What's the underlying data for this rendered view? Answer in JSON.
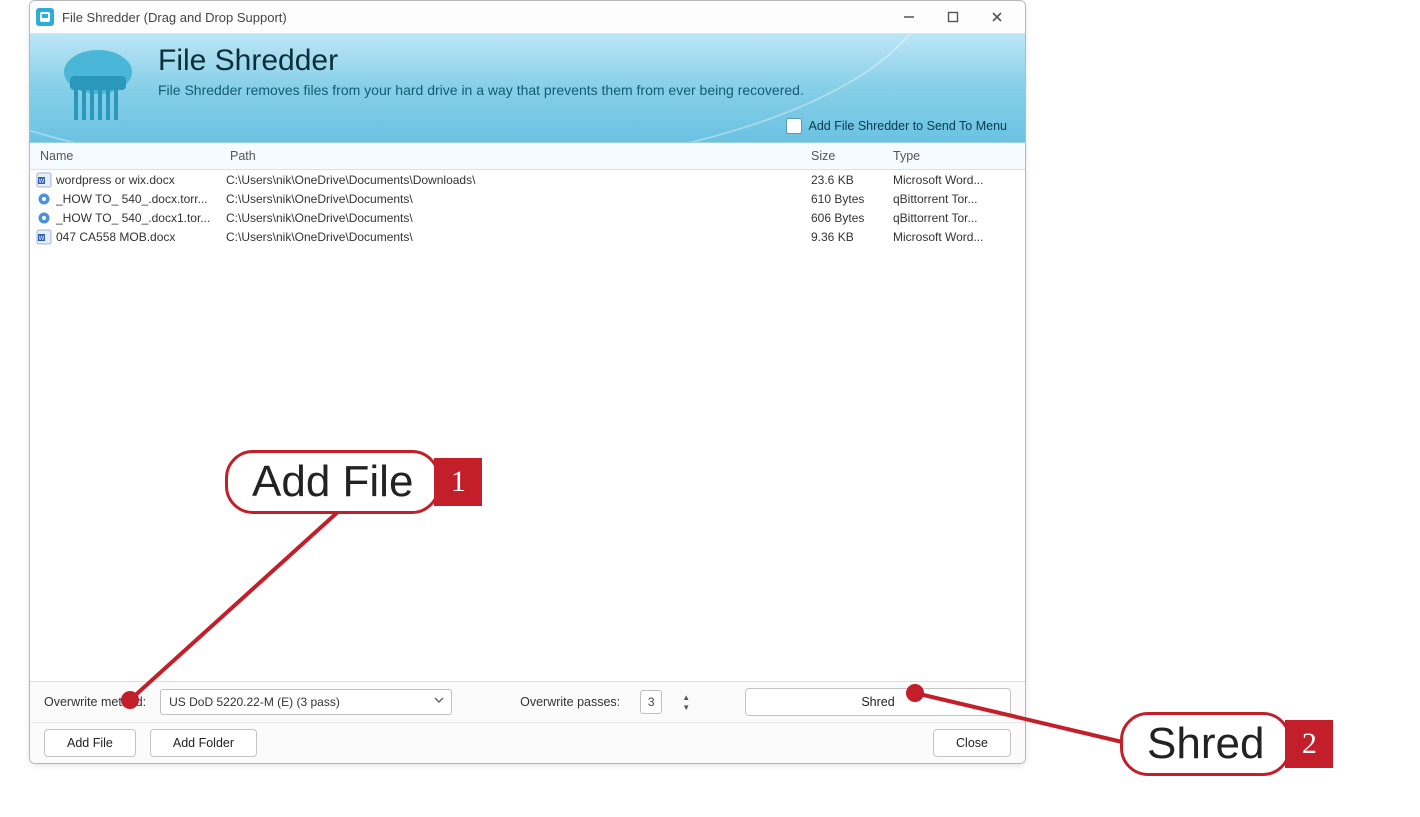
{
  "window": {
    "title": "File Shredder (Drag and Drop Support)"
  },
  "banner": {
    "heading": "File Shredder",
    "subheading": "File Shredder removes files from your hard drive in a way that prevents them from ever being recovered.",
    "sendto_label": "Add File Shredder to Send To Menu"
  },
  "columns": {
    "name": "Name",
    "path": "Path",
    "size": "Size",
    "type": "Type"
  },
  "files": [
    {
      "icon": "docx",
      "name": "wordpress or wix.docx",
      "path": "C:\\Users\\nik\\OneDrive\\Documents\\Downloads\\",
      "size": "23.6 KB",
      "type": "Microsoft Word..."
    },
    {
      "icon": "torrent",
      "name": "_HOW TO_ 540_.docx.torr...",
      "path": "C:\\Users\\nik\\OneDrive\\Documents\\",
      "size": "610 Bytes",
      "type": "qBittorrent Tor..."
    },
    {
      "icon": "torrent",
      "name": "_HOW TO_ 540_.docx1.tor...",
      "path": "C:\\Users\\nik\\OneDrive\\Documents\\",
      "size": "606 Bytes",
      "type": "qBittorrent Tor..."
    },
    {
      "icon": "docx",
      "name": "047 CA558 MOB.docx",
      "path": "C:\\Users\\nik\\OneDrive\\Documents\\",
      "size": "9.36 KB",
      "type": "Microsoft Word..."
    }
  ],
  "bottom": {
    "overwrite_method_label": "Overwrite method:",
    "overwrite_method_value": "US DoD 5220.22-M (E) (3 pass)",
    "overwrite_passes_label": "Overwrite passes:",
    "overwrite_passes_value": "3",
    "shred_label": "Shred",
    "add_file_label": "Add File",
    "add_folder_label": "Add Folder",
    "close_label": "Close"
  },
  "annotations": {
    "callout1_text": "Add File",
    "callout1_num": "1",
    "callout2_text": "Shred",
    "callout2_num": "2"
  }
}
